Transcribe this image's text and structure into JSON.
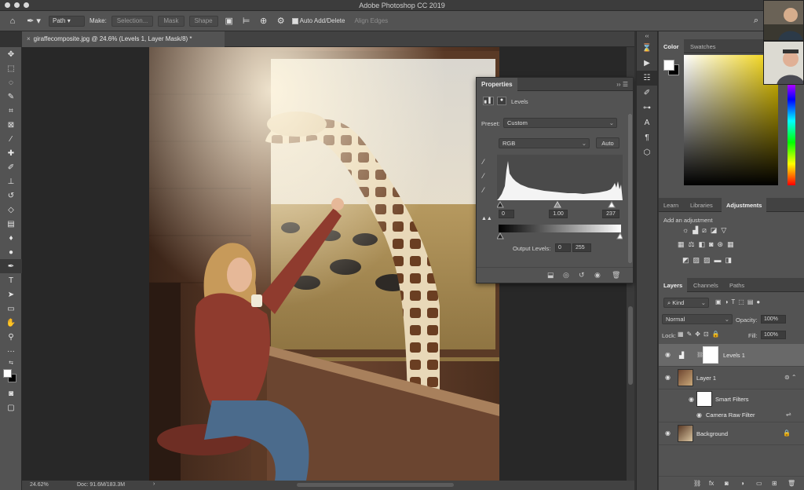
{
  "app": {
    "title": "Adobe Photoshop CC 2019"
  },
  "options_bar": {
    "mode": "Path",
    "make_label": "Make:",
    "selection_btn": "Selection...",
    "mask_btn": "Mask",
    "shape_btn": "Shape",
    "auto_add_delete": "Auto Add/Delete",
    "align_edges": "Align Edges"
  },
  "document": {
    "tab_title": "giraffecomposite.jpg @ 24.6% (Levels 1, Layer Mask/8) *"
  },
  "status": {
    "zoom": "24.62%",
    "doc_size": "Doc: 91.6M/183.3M"
  },
  "properties": {
    "tab": "Properties",
    "adjustment": "Levels",
    "preset_label": "Preset:",
    "preset_value": "Custom",
    "channel": "RGB",
    "auto_btn": "Auto",
    "input_black": "0",
    "input_gamma": "1.00",
    "input_white": "237",
    "output_label": "Output Levels:",
    "output_black": "0",
    "output_white": "255"
  },
  "panels": {
    "color_tabs": [
      "Color",
      "Swatches"
    ],
    "adj_tabs": [
      "Learn",
      "Libraries",
      "Adjustments"
    ],
    "add_adjustment": "Add an adjustment",
    "layer_tabs": [
      "Layers",
      "Channels",
      "Paths"
    ],
    "kind_filter": "Kind",
    "blend_mode": "Normal",
    "opacity_label": "Opacity:",
    "opacity_value": "100%",
    "lock_label": "Lock:",
    "fill_label": "Fill:",
    "fill_value": "100%"
  },
  "layers": [
    {
      "name": "Levels 1",
      "selected": true
    },
    {
      "name": "Layer 1",
      "selected": false
    },
    {
      "name": "Smart Filters",
      "selected": false
    },
    {
      "name": "Camera Raw Filter",
      "selected": false
    },
    {
      "name": "Background",
      "selected": false
    }
  ],
  "colors": {
    "panel_bg": "#535353",
    "dark_bg": "#282828",
    "selected_layer": "#696969"
  }
}
